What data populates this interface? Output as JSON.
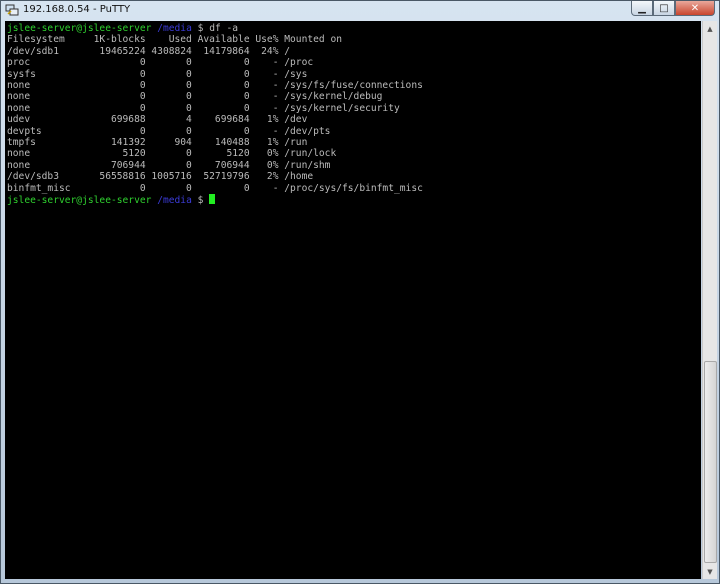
{
  "window": {
    "title": "192.168.0.54 - PuTTY",
    "controls": {
      "minimize": "▁",
      "maximize": "□",
      "close": "✕"
    }
  },
  "terminal": {
    "prompt": {
      "user_host": "jslee-server@jslee-server",
      "path": "/media",
      "symbol": "$"
    },
    "command": "df -a",
    "header": "Filesystem     1K-blocks    Used Available Use% Mounted on",
    "rows": [
      "/dev/sdb1       19465224 4308824  14179864  24% /",
      "proc                   0       0         0    - /proc",
      "sysfs                  0       0         0    - /sys",
      "none                   0       0         0    - /sys/fs/fuse/connections",
      "none                   0       0         0    - /sys/kernel/debug",
      "none                   0       0         0    - /sys/kernel/security",
      "udev              699688       4    699684   1% /dev",
      "devpts                 0       0         0    - /dev/pts",
      "tmpfs             141392     904    140488   1% /run",
      "none                5120       0      5120   0% /run/lock",
      "none              706944       0    706944   0% /run/shm",
      "/dev/sdb3       56558816 1005716  52719796   2% /home",
      "binfmt_misc            0       0         0    - /proc/sys/fs/binfmt_misc"
    ]
  },
  "colors": {
    "prompt_user": "#2fd12f",
    "prompt_path": "#3b3bd6",
    "text": "#bbbbbb",
    "cursor": "#22ee22"
  },
  "icons": {
    "app": "putty-icon",
    "scroll_up": "▲",
    "scroll_down": "▼"
  }
}
